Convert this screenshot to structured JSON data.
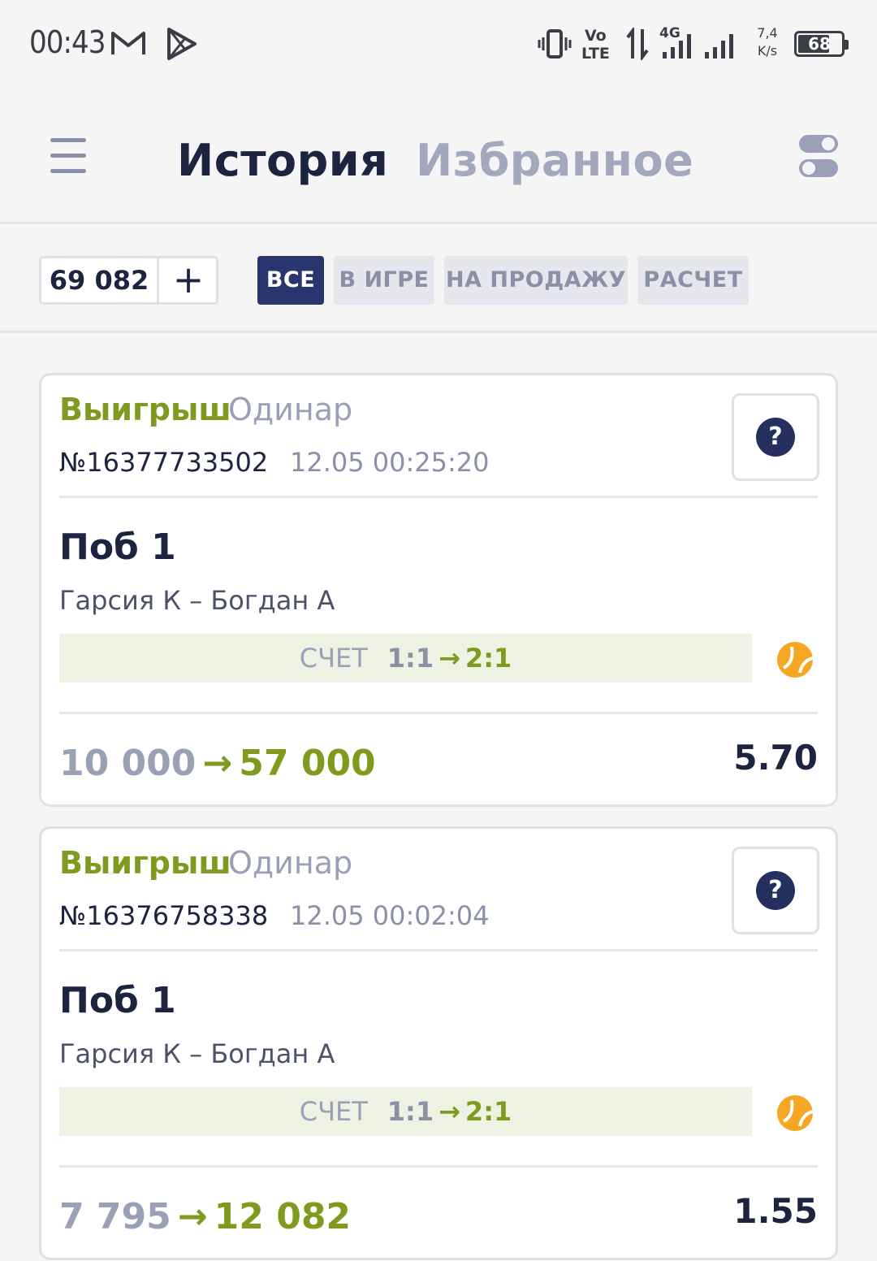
{
  "status_bar": {
    "time": "00:43",
    "net_speed_value": "7,4",
    "net_speed_unit": "K/s",
    "battery": "68",
    "icons": [
      "gmail-icon",
      "play-store-icon",
      "vibrate-icon",
      "volte-icon",
      "data-transfer-icon",
      "signal-4g-icon",
      "signal-icon",
      "battery-icon"
    ]
  },
  "header": {
    "tabs": [
      {
        "label": "История",
        "active": true
      },
      {
        "label": "Избранное",
        "active": false
      }
    ]
  },
  "filters": {
    "balance": "69 082",
    "add_label": "+",
    "chips": [
      {
        "label": "ВСЕ",
        "active": true
      },
      {
        "label": "В ИГРЕ",
        "active": false
      },
      {
        "label": "НА ПРОДАЖУ",
        "active": false
      },
      {
        "label": "РАСЧЕТ",
        "active": false
      }
    ]
  },
  "bets": [
    {
      "status": "Выигрыш",
      "type": "Одинар",
      "number": "№16377733502",
      "datetime": "12.05 00:25:20",
      "help": "?",
      "pick": "Поб 1",
      "event": "Гарсия К – Богдан А",
      "score_label": "СЧЕТ",
      "score_from": "1:1",
      "score_arrow": "→",
      "score_to": "2:1",
      "stake": "10 000",
      "amount_arrow": "→",
      "win": "57 000",
      "odds": "5.70"
    },
    {
      "status": "Выигрыш",
      "type": "Одинар",
      "number": "№16376758338",
      "datetime": "12.05 00:02:04",
      "help": "?",
      "pick": "Поб 1",
      "event": "Гарсия К – Богдан А",
      "score_label": "СЧЕТ",
      "score_from": "1:1",
      "score_arrow": "→",
      "score_to": "2:1",
      "stake": "7 795",
      "amount_arrow": "→",
      "win": "12 082",
      "odds": "1.55"
    }
  ],
  "colors": {
    "accent_dark": "#2a3570",
    "win_green": "#7f9a1f",
    "muted": "#9aa0b6",
    "tennis_ball": "#f5a623"
  }
}
